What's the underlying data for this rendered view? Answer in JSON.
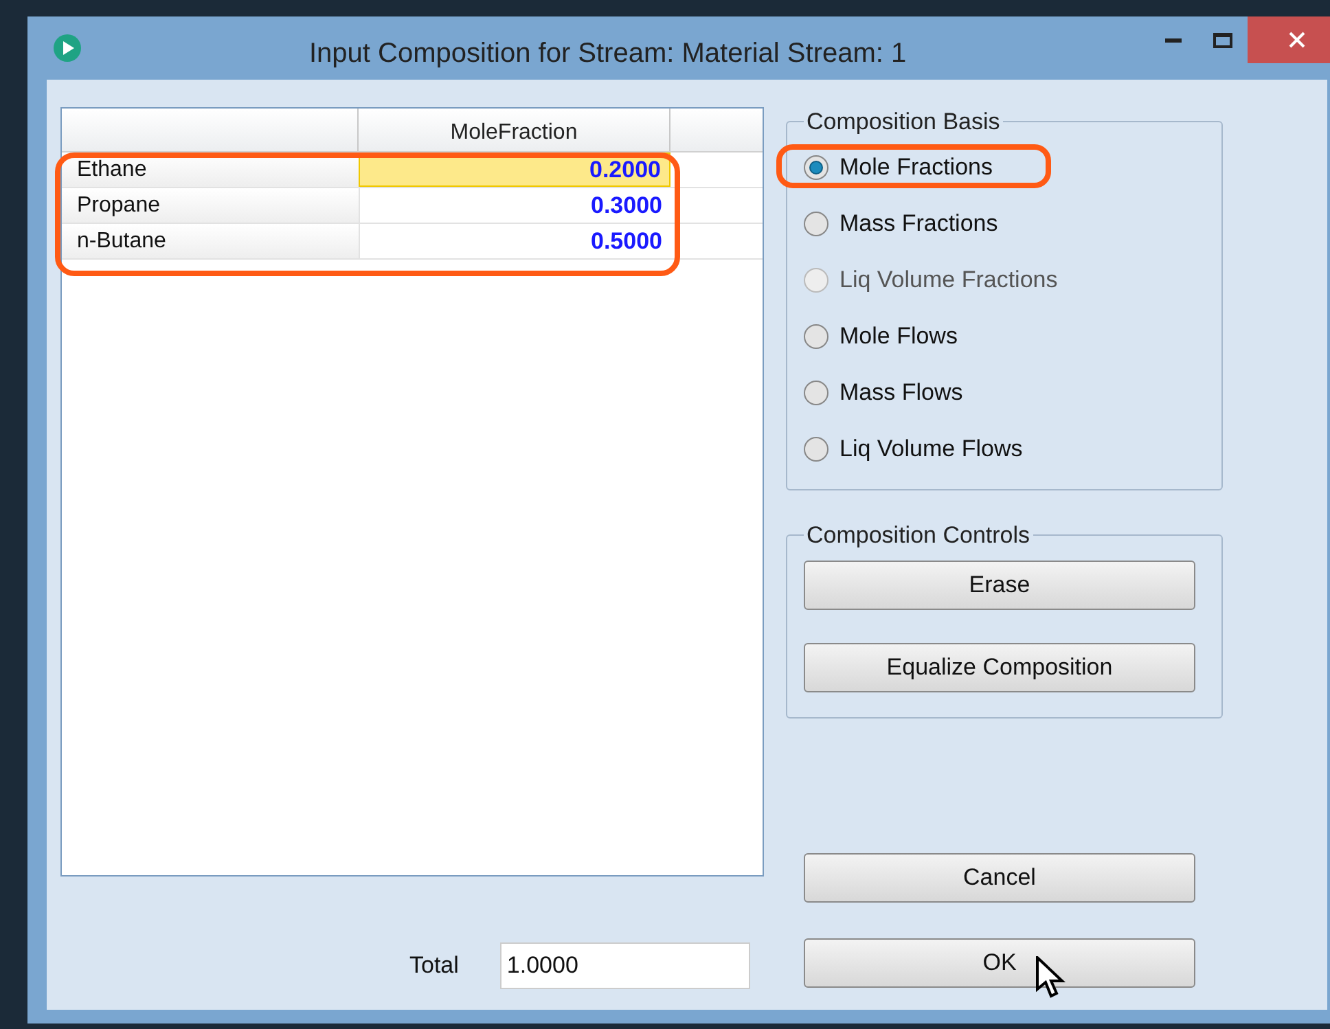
{
  "window": {
    "title": "Input Composition for Stream: Material Stream: 1"
  },
  "table": {
    "columns": [
      "MoleFraction"
    ],
    "rows": [
      {
        "name": "Ethane",
        "value": "0.2000",
        "selected": true
      },
      {
        "name": "Propane",
        "value": "0.3000",
        "selected": false
      },
      {
        "name": "n-Butane",
        "value": "0.5000",
        "selected": false
      }
    ]
  },
  "composition_basis": {
    "title": "Composition Basis",
    "options": [
      {
        "label": "Mole Fractions",
        "selected": true,
        "disabled": false
      },
      {
        "label": "Mass Fractions",
        "selected": false,
        "disabled": false
      },
      {
        "label": "Liq Volume Fractions",
        "selected": false,
        "disabled": true
      },
      {
        "label": "Mole Flows",
        "selected": false,
        "disabled": false
      },
      {
        "label": "Mass Flows",
        "selected": false,
        "disabled": false
      },
      {
        "label": "Liq Volume Flows",
        "selected": false,
        "disabled": false
      }
    ]
  },
  "composition_controls": {
    "title": "Composition Controls",
    "buttons": [
      "Erase",
      "Equalize Composition"
    ]
  },
  "total": {
    "label": "Total",
    "value": "1.0000"
  },
  "buttons": [
    "Cancel",
    "OK"
  ]
}
